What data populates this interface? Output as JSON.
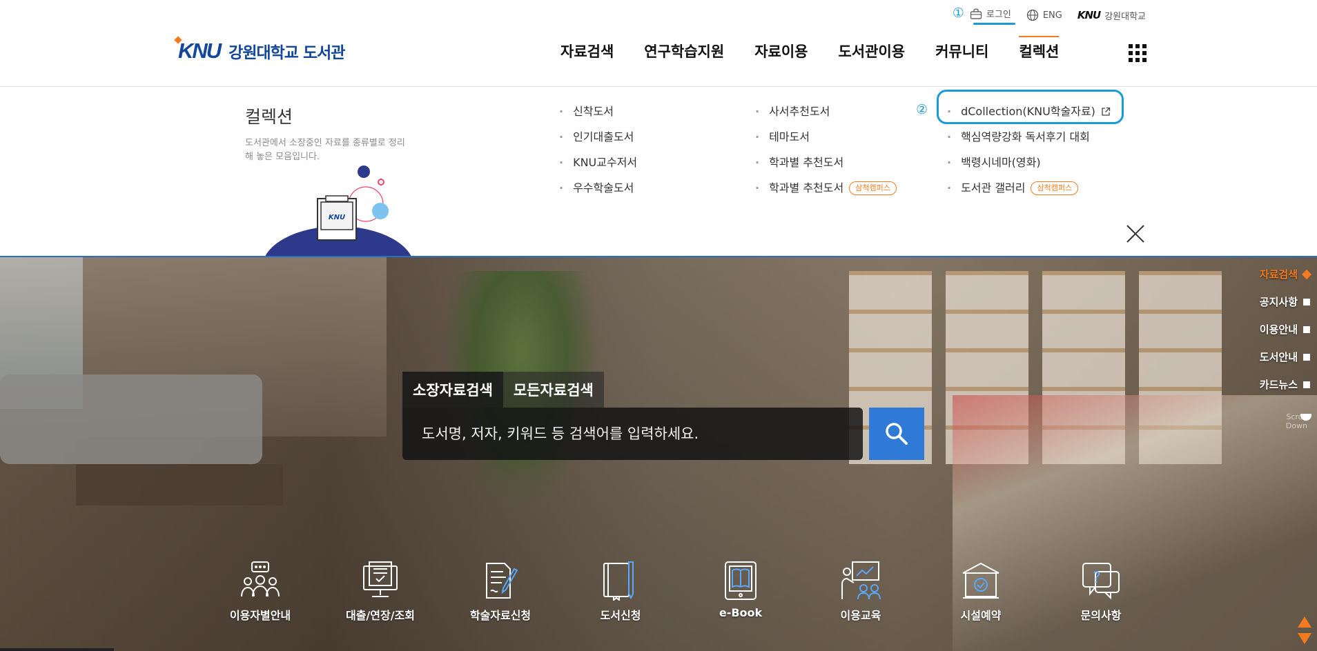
{
  "utility": {
    "marker1": "①",
    "login": "로그인",
    "eng": "ENG",
    "knu_mini_logo": "KNU",
    "knu_mini_text": "강원대학교"
  },
  "logo": {
    "mark": "KNU",
    "text": "강원대학교 도서관"
  },
  "gnb": [
    {
      "label": "자료검색"
    },
    {
      "label": "연구학습지원"
    },
    {
      "label": "자료이용"
    },
    {
      "label": "도서관이용"
    },
    {
      "label": "커뮤니티"
    },
    {
      "label": "컬렉션",
      "active": true
    }
  ],
  "mega": {
    "title": "컬렉션",
    "description": "도서관에서 소장중인 자료를 종류별로 정리해 놓은 모음입니다.",
    "illustration_label": "KNU",
    "marker2": "②",
    "col1": [
      "신착도서",
      "인기대출도서",
      "KNU교수저서",
      "우수학술도서"
    ],
    "col2": [
      "사서추천도서",
      "테마도서",
      "학과별 추천도서",
      "학과별 추천도서"
    ],
    "col2_badge": "삼척캠퍼스",
    "col3": [
      "dCollection(KNU학술자료)",
      "핵심역량강화 독서후기 대회",
      "백령시네마(영화)",
      "도서관 갤러리"
    ],
    "col3_badge": "삼척캠퍼스"
  },
  "search": {
    "tabs": [
      "소장자료검색",
      "모든자료검색"
    ],
    "placeholder": "도서명, 저자, 키워드 등 검색어를 입력하세요."
  },
  "quick_menu": [
    {
      "label": "이용자별안내",
      "icon": "users-guide-icon"
    },
    {
      "label": "대출/연장/조회",
      "icon": "loan-monitor-icon"
    },
    {
      "label": "학술자료신청",
      "icon": "document-pen-icon"
    },
    {
      "label": "도서신청",
      "icon": "book-pen-icon"
    },
    {
      "label": "e-Book",
      "icon": "ebook-icon"
    },
    {
      "label": "이용교육",
      "icon": "education-icon"
    },
    {
      "label": "시설예약",
      "icon": "facility-icon"
    },
    {
      "label": "문의사항",
      "icon": "question-chat-icon"
    }
  ],
  "side_nav": [
    "자료검색",
    "공지사항",
    "이용안내",
    "도서안내",
    "카드뉴스"
  ],
  "scroll_hint": {
    "line1": "Scroll",
    "line2": "Down"
  },
  "colors": {
    "brand_blue": "#13479c",
    "accent_orange": "#f47a20",
    "highlight_cyan": "#1a9ad8",
    "search_blue": "#2f7ad6"
  }
}
